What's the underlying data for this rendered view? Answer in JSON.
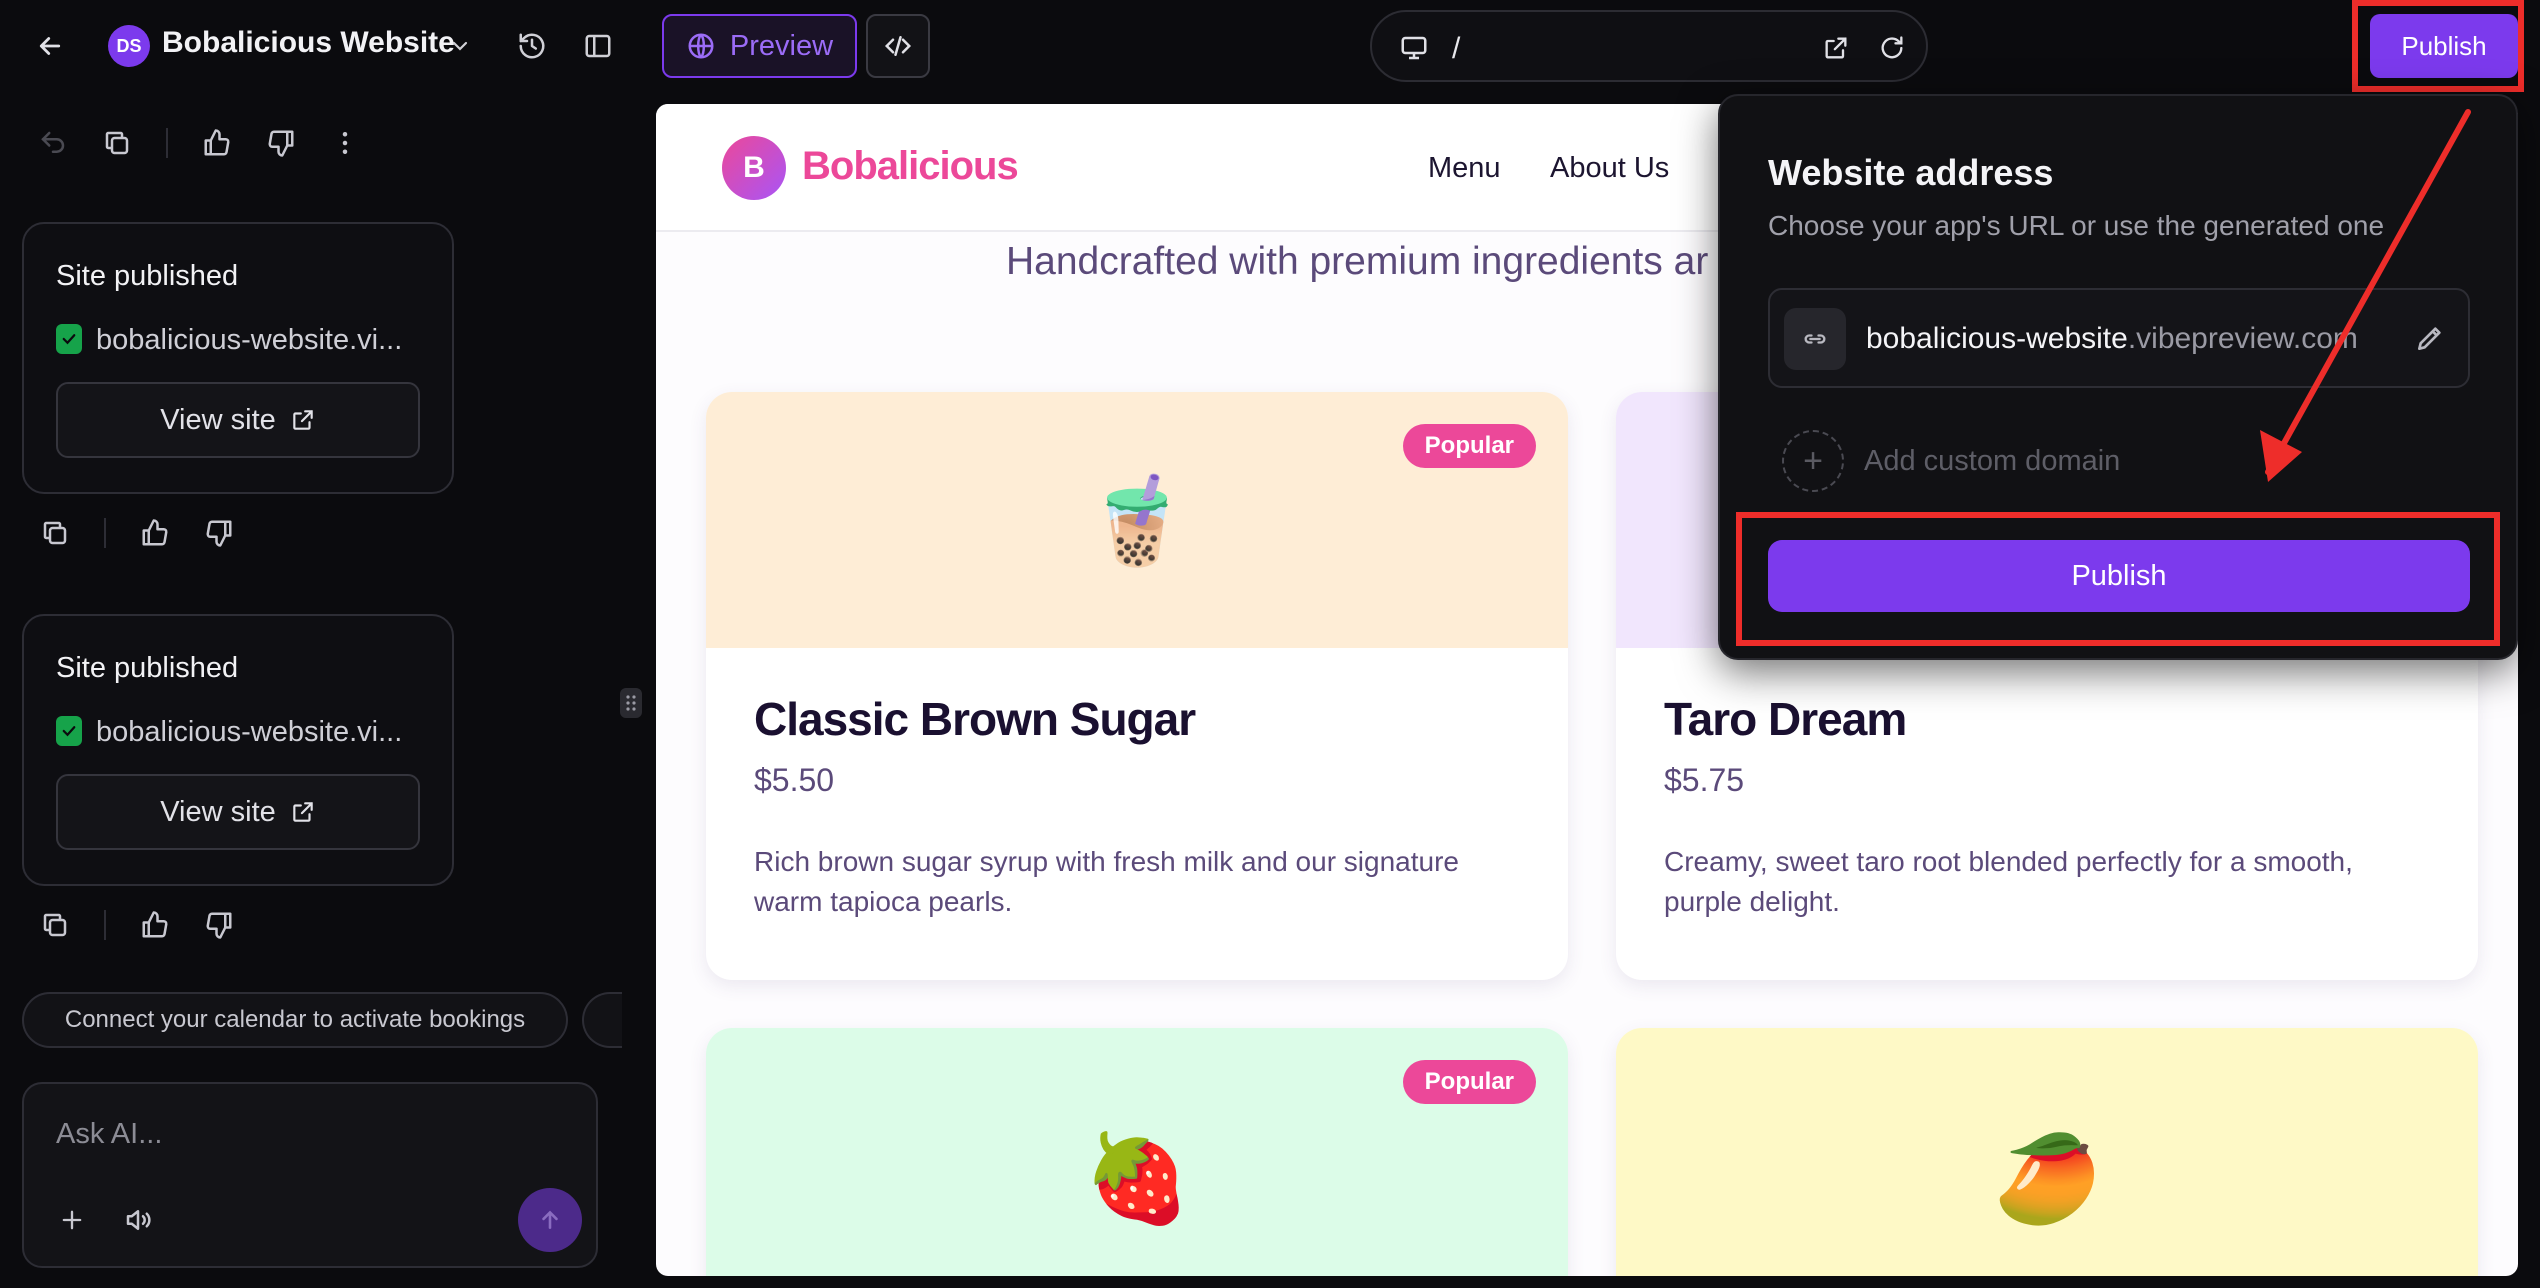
{
  "header": {
    "project_initials": "DS",
    "project_title": "Bobalicious Website",
    "preview_label": "Preview",
    "url_path": "/",
    "publish_label": "Publish"
  },
  "chat": {
    "cards": [
      {
        "title": "Site published",
        "url": "bobalicious-website.vi...",
        "button": "View site"
      },
      {
        "title": "Site published",
        "url": "bobalicious-website.vi...",
        "button": "View site"
      }
    ],
    "suggestion": "Connect your calendar to activate bookings",
    "input_placeholder": "Ask AI..."
  },
  "site": {
    "logo_letter": "B",
    "brand": "Bobalicious",
    "nav": [
      "Menu",
      "About Us"
    ],
    "hero_subtitle": "Handcrafted with premium ingredients ar",
    "products": [
      {
        "name": "Classic Brown Sugar",
        "price": "$5.50",
        "description": "Rich brown sugar syrup with fresh milk and our signature warm tapioca pearls.",
        "badge": "Popular",
        "emoji": "🧋",
        "bg": "#feedd6"
      },
      {
        "name": "Taro Dream",
        "price": "$5.75",
        "description": "Creamy, sweet taro root blended perfectly for a smooth, purple delight.",
        "badge": "",
        "emoji": "",
        "bg": "#f1e6fd"
      },
      {
        "name": "",
        "price": "",
        "description": "",
        "badge": "Popular",
        "emoji": "🍓",
        "bg": "#dcfce8"
      },
      {
        "name": "",
        "price": "",
        "description": "",
        "badge": "",
        "emoji": "🥭",
        "bg": "#fef9c6"
      }
    ]
  },
  "popover": {
    "title": "Website address",
    "subtitle": "Choose your app's URL or use the generated one",
    "subdomain": "bobalicious-website",
    "suffix": ".vibepreview.com",
    "custom_domain_label": "Add custom domain",
    "publish_label": "Publish"
  },
  "colors": {
    "accent": "#7c3aed",
    "highlight_red": "#ee2d2a",
    "brand_pink": "#ec4899"
  }
}
